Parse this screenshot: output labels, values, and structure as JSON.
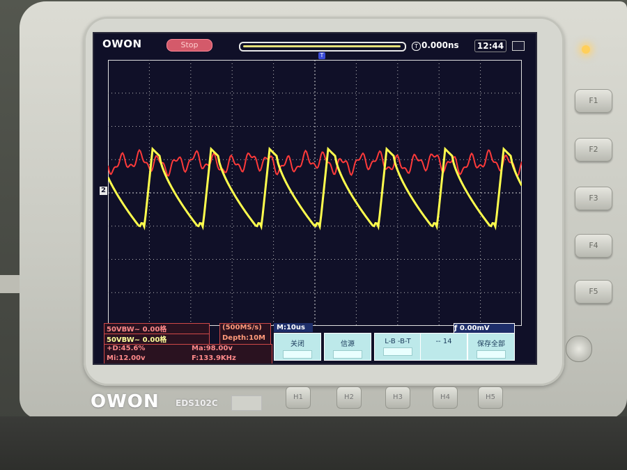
{
  "device": {
    "logo": "OWON",
    "model": "EDS102C",
    "side_buttons": [
      "F1",
      "F2",
      "F3",
      "F4",
      "F5"
    ],
    "bottom_buttons": [
      "H1",
      "H2",
      "H3",
      "H4",
      "H5"
    ]
  },
  "screen": {
    "brand": "OWON",
    "status": "Stop",
    "time_position": "0.000ns",
    "clock": "12:44",
    "trigger_marker": "T",
    "ch2_marker": "2",
    "time_icon": "T"
  },
  "readouts": {
    "ch1": "50VBW~   0.00格",
    "ch2": "50VBW~   0.00格",
    "sample_rate": "(500MS/s)",
    "depth": "Depth:10M",
    "duty": "+D:45.6%",
    "min": "Mi:12.00v",
    "max": "Ma:98.00v",
    "freq": "F:133.9KHz",
    "timebase": "M:10us",
    "trigger": "ƒ 0.00mV"
  },
  "soft_buttons": [
    "关闭",
    "信源",
    "L-B\n-B-T",
    "-- 14",
    "保存全部"
  ],
  "colors": {
    "ch1": "#ffff4d",
    "ch2": "#ff3a3a",
    "grid": "#bfbfbf"
  }
}
